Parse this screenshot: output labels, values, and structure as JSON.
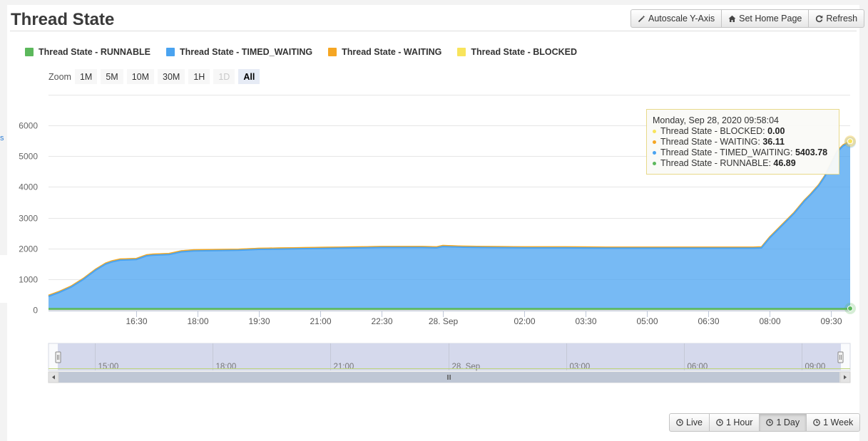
{
  "page": {
    "title": "Thread State"
  },
  "toolbar": {
    "autoscale": "Autoscale Y-Axis",
    "set_home": "Set Home Page",
    "refresh": "Refresh"
  },
  "legend": [
    {
      "label": "Thread State - RUNNABLE",
      "color": "#5cb85c"
    },
    {
      "label": "Thread State - TIMED_WAITING",
      "color": "#4aa3f0"
    },
    {
      "label": "Thread State - WAITING",
      "color": "#f5a623"
    },
    {
      "label": "Thread State - BLOCKED",
      "color": "#f8e45c"
    }
  ],
  "zoom": {
    "label": "Zoom",
    "buttons": [
      "1M",
      "5M",
      "10M",
      "30M",
      "1H",
      "1D",
      "All"
    ],
    "disabled": "1D",
    "selected": "All"
  },
  "tooltip": {
    "header": "Monday, Sep 28, 2020 09:58:04",
    "rows": [
      {
        "label": "Thread State - BLOCKED: ",
        "value": "0.00",
        "color": "#f8e45c"
      },
      {
        "label": "Thread State - WAITING: ",
        "value": "36.11",
        "color": "#f5a623"
      },
      {
        "label": "Thread State - TIMED_WAITING: ",
        "value": "5403.78",
        "color": "#4aa3f0"
      },
      {
        "label": "Thread State - RUNNABLE: ",
        "value": "46.89",
        "color": "#5cb85c"
      }
    ]
  },
  "navigator": {
    "ticks": [
      "15:00",
      "18:00",
      "21:00",
      "28. Sep",
      "03:00",
      "06:00",
      "09:00"
    ]
  },
  "range_buttons": {
    "live": "Live",
    "hour": "1 Hour",
    "day": "1 Day",
    "week": "1 Week",
    "active": "1 Day"
  },
  "edge_text": "s",
  "chart_data": {
    "type": "area",
    "stacked": true,
    "ylim": [
      0,
      7000
    ],
    "yticks": [
      0,
      1000,
      2000,
      3000,
      4000,
      5000,
      6000
    ],
    "xticks": [
      {
        "t": 16.5,
        "label": "16:30"
      },
      {
        "t": 18.0,
        "label": "18:00"
      },
      {
        "t": 19.5,
        "label": "19:30"
      },
      {
        "t": 21.0,
        "label": "21:00"
      },
      {
        "t": 22.5,
        "label": "22:30"
      },
      {
        "t": 24.0,
        "label": "28. Sep"
      },
      {
        "t": 26.0,
        "label": "02:00"
      },
      {
        "t": 27.5,
        "label": "03:30"
      },
      {
        "t": 29.0,
        "label": "05:00"
      },
      {
        "t": 30.5,
        "label": "06:30"
      },
      {
        "t": 32.0,
        "label": "08:00"
      },
      {
        "t": 33.5,
        "label": "09:30"
      }
    ],
    "x_unit": "hours from Sep 27 00:00",
    "xlim": [
      14.35,
      33.97
    ],
    "x": [
      14.35,
      14.6,
      14.9,
      15.2,
      15.5,
      15.75,
      15.9,
      16.1,
      16.3,
      16.5,
      16.75,
      16.9,
      17.3,
      17.6,
      17.9,
      18.5,
      19.0,
      19.5,
      20.0,
      20.5,
      21.0,
      21.5,
      22.0,
      22.5,
      23.0,
      23.5,
      23.85,
      24.0,
      24.5,
      25.0,
      26.0,
      27.0,
      28.0,
      29.0,
      30.0,
      31.0,
      31.6,
      31.8,
      32.0,
      32.3,
      32.6,
      32.85,
      33.0,
      33.2,
      33.35,
      33.5,
      33.65,
      33.8,
      33.97
    ],
    "series": [
      {
        "name": "Thread State - BLOCKED",
        "color": "#f8e45c",
        "values": [
          0,
          0,
          0,
          0,
          0,
          0,
          0,
          0,
          0,
          0,
          0,
          0,
          0,
          0,
          0,
          0,
          0,
          0,
          0,
          0,
          0,
          0,
          0,
          0,
          0,
          0,
          0,
          0,
          0,
          0,
          0,
          0,
          0,
          0,
          0,
          0,
          0,
          0,
          0,
          0,
          0,
          0,
          0,
          0,
          0,
          0,
          0,
          0,
          0
        ]
      },
      {
        "name": "Thread State - WAITING",
        "color": "#f5a623",
        "values": [
          30,
          30,
          30,
          30,
          30,
          30,
          30,
          30,
          30,
          30,
          30,
          30,
          30,
          30,
          30,
          30,
          30,
          30,
          30,
          30,
          30,
          30,
          30,
          30,
          30,
          30,
          30,
          30,
          30,
          30,
          30,
          30,
          30,
          30,
          30,
          30,
          30,
          30,
          30,
          30,
          30,
          30,
          30,
          30,
          30,
          30,
          30,
          30,
          36.11
        ]
      },
      {
        "name": "Thread State - TIMED_WAITING",
        "color": "#4aa3f0",
        "values": [
          400,
          520,
          700,
          950,
          1250,
          1450,
          1520,
          1580,
          1590,
          1600,
          1720,
          1740,
          1760,
          1850,
          1880,
          1890,
          1900,
          1930,
          1940,
          1950,
          1960,
          1970,
          1980,
          1990,
          1990,
          1990,
          1980,
          2020,
          2000,
          1990,
          1980,
          1980,
          1970,
          1970,
          1970,
          1970,
          1970,
          1980,
          2300,
          2700,
          3100,
          3500,
          3700,
          4000,
          4300,
          4700,
          5100,
          5300,
          5403.78
        ]
      },
      {
        "name": "Thread State - RUNNABLE",
        "color": "#5cb85c",
        "values": [
          40,
          40,
          40,
          40,
          40,
          40,
          40,
          40,
          40,
          40,
          40,
          40,
          40,
          40,
          40,
          40,
          40,
          40,
          40,
          40,
          40,
          40,
          40,
          40,
          40,
          40,
          40,
          40,
          40,
          40,
          40,
          40,
          40,
          40,
          40,
          40,
          40,
          40,
          40,
          40,
          40,
          40,
          40,
          40,
          40,
          40,
          40,
          40,
          46.89
        ]
      }
    ]
  }
}
